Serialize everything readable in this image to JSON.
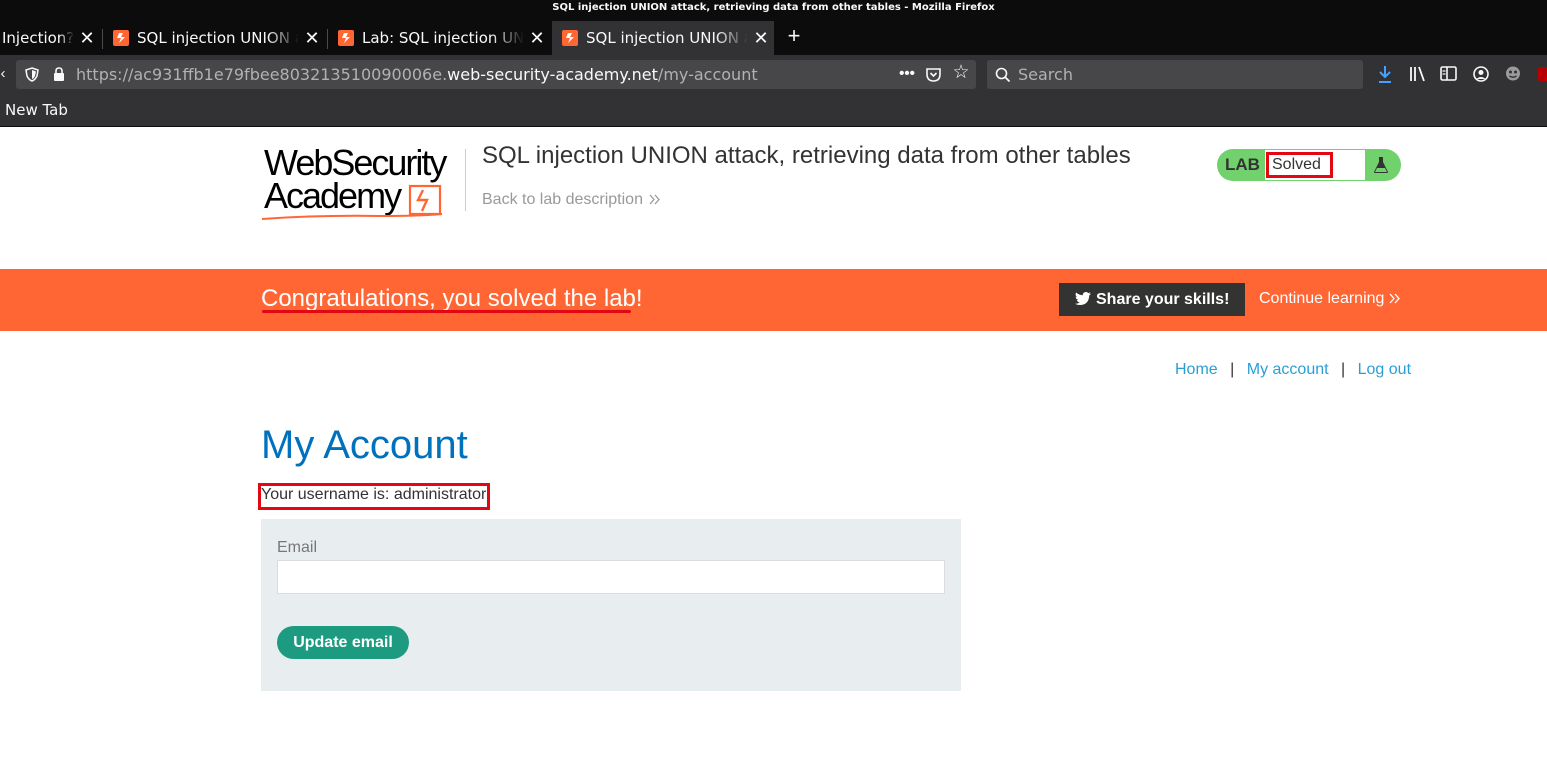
{
  "window": {
    "title": "SQL injection UNION attack, retrieving data from other tables - Mozilla Firefox"
  },
  "tabs": [
    {
      "label": "Injection?",
      "active": false
    },
    {
      "label": "SQL injection UNION attack",
      "active": false
    },
    {
      "label": "Lab: SQL injection UNION",
      "active": false
    },
    {
      "label": "SQL injection UNION attack",
      "active": true
    }
  ],
  "toolbar": {
    "url_prefix": "https://ac931ffb1e79fbee803213510090006e.",
    "url_domain": "web-security-academy.net",
    "url_path": "/my-account",
    "search_placeholder": "Search"
  },
  "bookmarks": {
    "new_tab": "New Tab"
  },
  "header": {
    "logo_line1": "WebSecurity",
    "logo_line2": "Academy",
    "lab_title": "SQL injection UNION attack, retrieving data from other tables",
    "back_link": "Back to lab description",
    "badge_label": "LAB",
    "badge_status": "Solved"
  },
  "banner": {
    "message": "Congratulations, you solved the lab!",
    "share_button": "Share your skills!",
    "continue_link": "Continue learning"
  },
  "nav": {
    "home": "Home",
    "my_account": "My account",
    "logout": "Log out",
    "separator": "|"
  },
  "main": {
    "heading": "My Account",
    "username_text": "Your username is: administrator",
    "email_label": "Email",
    "email_value": "",
    "update_button": "Update email"
  },
  "colors": {
    "brand_orange": "#ff6633",
    "badge_green": "#70d16d",
    "button_teal": "#1d9b80",
    "heading_blue": "#0071bc",
    "link_blue": "#2a9fd6",
    "annotation_red": "#e30613"
  }
}
